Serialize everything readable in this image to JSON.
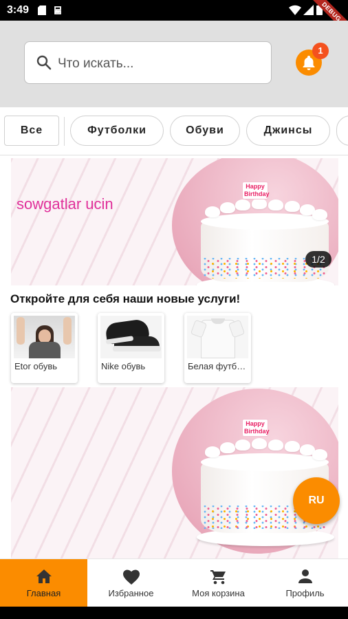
{
  "status_bar": {
    "time": "3:49",
    "debug_label": "DEBUG"
  },
  "search": {
    "placeholder": "Что искать..."
  },
  "notifications": {
    "count": "1"
  },
  "categories": [
    {
      "label": "Все"
    },
    {
      "label": "Футболки"
    },
    {
      "label": "Обуви"
    },
    {
      "label": "Джинсы"
    }
  ],
  "banners": [
    {
      "title": "sowgatlar ucin",
      "page_indicator": "1/2",
      "topper_line1": "Happy",
      "topper_line2": "Birthday"
    },
    {
      "topper_line1": "Happy",
      "topper_line2": "Birthday"
    }
  ],
  "services": {
    "title": "Откройте для себя наши новые услуги!",
    "items": [
      {
        "label": "Etor обувь"
      },
      {
        "label": "Nike обувь"
      },
      {
        "label": "Белая футболка"
      }
    ]
  },
  "language_button": {
    "label": "RU"
  },
  "bottom_nav": {
    "items": [
      {
        "label": "Главная",
        "icon": "home-icon",
        "active": true
      },
      {
        "label": "Избранное",
        "icon": "heart-icon"
      },
      {
        "label": "Моя корзина",
        "icon": "cart-icon"
      },
      {
        "label": "Профиль",
        "icon": "person-icon"
      }
    ]
  },
  "colors": {
    "accent": "#fb8c00",
    "badge": "#f4511e",
    "banner_title": "#e0309a"
  }
}
